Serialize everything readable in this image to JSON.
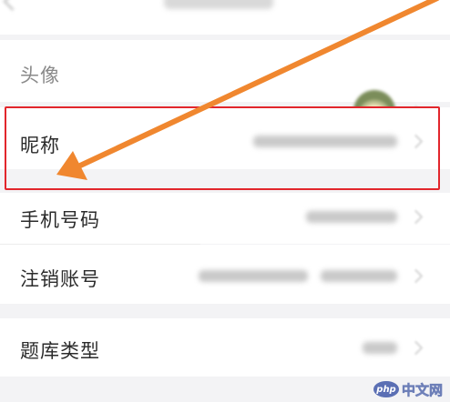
{
  "rows": [
    {
      "label": "头像"
    },
    {
      "label": "昵称"
    },
    {
      "label": "手机号码"
    },
    {
      "label": "注销账号"
    },
    {
      "label": "题库类型"
    }
  ],
  "watermark": {
    "logo": "php",
    "text": "中文网"
  },
  "colors": {
    "highlight": "#e2262c",
    "arrow": "#f0872f",
    "background": "#f3f3f5",
    "row_background": "#ffffff"
  },
  "icons": {
    "back": "back-icon",
    "chevron": "chevron-right-icon"
  }
}
